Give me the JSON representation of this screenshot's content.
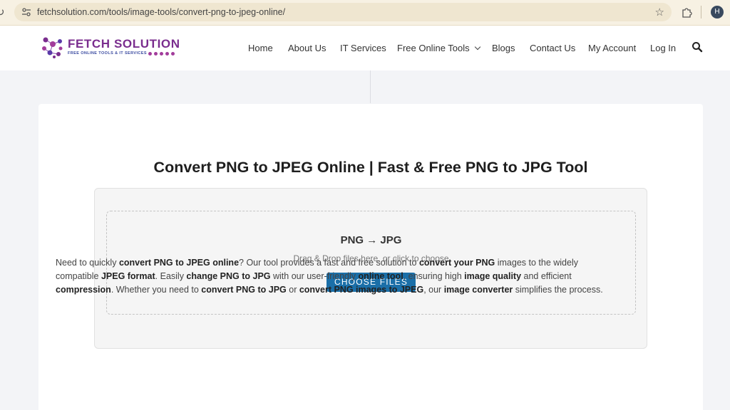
{
  "browser": {
    "url": "fetchsolution.com/tools/image-tools/convert-png-to-jpeg-online/",
    "avatar_letter": "H"
  },
  "site": {
    "logo_title": "FETCH SOLUTION",
    "logo_subtitle": "FREE ONLINE TOOLS & IT SERVICES",
    "brand_color": "#7a2d8e"
  },
  "nav": {
    "items": [
      {
        "label": "Home"
      },
      {
        "label": "About Us"
      },
      {
        "label": "IT Services"
      },
      {
        "label": "Free Online Tools"
      },
      {
        "label": "Blogs"
      },
      {
        "label": "Contact Us"
      },
      {
        "label": "My Account"
      },
      {
        "label": "Log In"
      }
    ],
    "search_icon": "search-icon"
  },
  "main": {
    "title": "Convert PNG to JPEG Online | Fast & Free PNG to JPG Tool",
    "converter": {
      "heading": "PNG → JPG",
      "hint": "Drag & Drop files here, or click to choose",
      "button_label": "CHOOSE FILES",
      "button_color": "#1b6fa8"
    },
    "description": [
      {
        "t": "Need to quickly ",
        "b": false
      },
      {
        "t": "convert PNG to JPEG online",
        "b": true
      },
      {
        "t": "? Our tool provides a fast and free solution to ",
        "b": false
      },
      {
        "t": "convert your PNG",
        "b": true
      },
      {
        "t": " images to the widely compatible ",
        "b": false
      },
      {
        "t": "JPEG format",
        "b": true
      },
      {
        "t": ". Easily ",
        "b": false
      },
      {
        "t": "change PNG to JPG",
        "b": true
      },
      {
        "t": " with our user-friendly ",
        "b": false
      },
      {
        "t": "online tool",
        "b": true
      },
      {
        "t": ", ensuring high ",
        "b": false
      },
      {
        "t": "image quality",
        "b": true
      },
      {
        "t": " and efficient ",
        "b": false
      },
      {
        "t": "compression",
        "b": true
      },
      {
        "t": ". Whether you need to ",
        "b": false
      },
      {
        "t": "convert PNG to JPG",
        "b": true
      },
      {
        "t": " or ",
        "b": false
      },
      {
        "t": "convert PNG images to JPEG",
        "b": true
      },
      {
        "t": ", our ",
        "b": false
      },
      {
        "t": "image converter",
        "b": true
      },
      {
        "t": " simplifies the process.",
        "b": false
      }
    ]
  }
}
